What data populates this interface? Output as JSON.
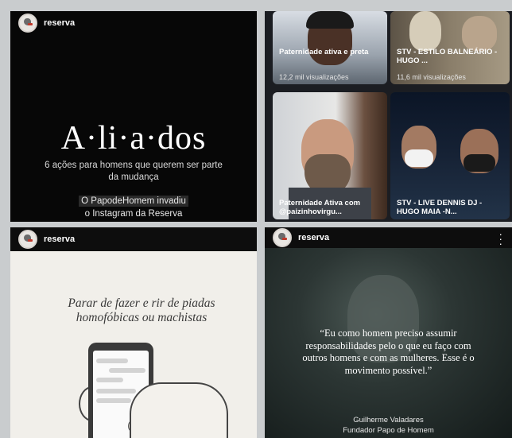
{
  "post1": {
    "username": "reserva",
    "title": "A·li·a·dos",
    "subtitle": "6 ações para homens que querem ser parte da mudança",
    "footer_line1": "O PapodeHomem invadiu",
    "footer_line2": "o Instagram da Reserva"
  },
  "videos": [
    {
      "caption": "Paternidade ativa e preta",
      "views": "12,2 mil visualizações"
    },
    {
      "caption": "STV - ESTILO BALNEÁRIO - HUGO ...",
      "views": "11,6 mil visualizações"
    },
    {
      "caption": "Paternidade Ativa com @paizinhovirgu...",
      "views": ""
    },
    {
      "caption": "STV - LIVE DENNIS DJ - HUGO MAIA -N...",
      "views": ""
    }
  ],
  "post3": {
    "username": "reserva",
    "phrase": "Parar de fazer e rir de piadas homofóbicas ou machistas"
  },
  "post4": {
    "username": "reserva",
    "more_icon": "more-vertical-icon",
    "quote": "“Eu como homem preciso assumir responsabilidades pelo o que eu faço com outros homens e com as mulheres. Esse é o movimento possível.”",
    "author": "Guilherme Valadares",
    "role": "Fundador Papo de Homem"
  }
}
